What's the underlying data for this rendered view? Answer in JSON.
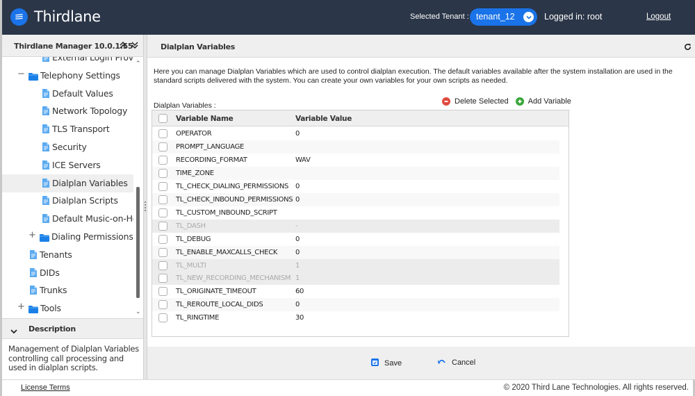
{
  "header": {
    "brand": "Thirdlane",
    "tenant_label": "Selected Tenant :",
    "tenant_value": "tenant_12",
    "logged_in": "Logged in: root",
    "logout": "Logout",
    "accent_color": "#1a73e8",
    "bar_color": "#2b3648"
  },
  "left_panel": {
    "title": "Thirdlane Manager 10.0.1.55",
    "tree": [
      {
        "label": "External Login Provi...",
        "type": "file",
        "level": 2,
        "partial": true
      },
      {
        "label": "Telephony Settings",
        "type": "folder",
        "level": 1,
        "toggle": "−"
      },
      {
        "label": "Default Values",
        "type": "file",
        "level": 2
      },
      {
        "label": "Network Topology",
        "type": "file",
        "level": 2
      },
      {
        "label": "TLS Transport",
        "type": "file",
        "level": 2
      },
      {
        "label": "Security",
        "type": "file",
        "level": 2
      },
      {
        "label": "ICE Servers",
        "type": "file",
        "level": 2
      },
      {
        "label": "Dialplan Variables",
        "type": "file",
        "level": 2,
        "selected": true
      },
      {
        "label": "Dialplan Scripts",
        "type": "file",
        "level": 2
      },
      {
        "label": "Default Music-on-Hold",
        "type": "file",
        "level": 2
      },
      {
        "label": "Dialing Permissions",
        "type": "folder",
        "level": 2,
        "toggle": "+"
      },
      {
        "label": "Tenants",
        "type": "file",
        "level": 1
      },
      {
        "label": "DIDs",
        "type": "file",
        "level": 1
      },
      {
        "label": "Trunks",
        "type": "file",
        "level": 1
      },
      {
        "label": "Tools",
        "type": "folder",
        "level": 1,
        "toggle": "+"
      }
    ],
    "description_title": "Description",
    "description_text": "Management of Dialplan Variables controlling call processing and used in dialplan scripts."
  },
  "main": {
    "title": "Dialplan Variables",
    "intro": "Here you can manage Dialplan Variables which are used to control dialplan execution. The default variables available after the system installation are used in the standard scripts delivered with the system. You can create your own variables for your own scripts as needed.",
    "grid_label": "Dialplan Variables :",
    "delete_label": "Delete Selected",
    "add_label": "Add Variable",
    "columns": [
      "Variable Name",
      "Variable Value"
    ],
    "rows": [
      {
        "name": "OPERATOR",
        "value": "0",
        "disabled": false
      },
      {
        "name": "PROMPT_LANGUAGE",
        "value": "",
        "disabled": false
      },
      {
        "name": "RECORDING_FORMAT",
        "value": "WAV",
        "disabled": false
      },
      {
        "name": "TIME_ZONE",
        "value": "",
        "disabled": false
      },
      {
        "name": "TL_CHECK_DIALING_PERMISSIONS",
        "value": "0",
        "disabled": false
      },
      {
        "name": "TL_CHECK_INBOUND_PERMISSIONS",
        "value": "0",
        "disabled": false
      },
      {
        "name": "TL_CUSTOM_INBOUND_SCRIPT",
        "value": "",
        "disabled": false
      },
      {
        "name": "TL_DASH",
        "value": "-",
        "disabled": true
      },
      {
        "name": "TL_DEBUG",
        "value": "0",
        "disabled": false
      },
      {
        "name": "TL_ENABLE_MAXCALLS_CHECK",
        "value": "0",
        "disabled": false
      },
      {
        "name": "TL_MULTI",
        "value": "1",
        "disabled": true
      },
      {
        "name": "TL_NEW_RECORDING_MECHANISM",
        "value": "1",
        "disabled": true
      },
      {
        "name": "TL_ORIGINATE_TIMEOUT",
        "value": "60",
        "disabled": false
      },
      {
        "name": "TL_REROUTE_LOCAL_DIDS",
        "value": "0",
        "disabled": false
      },
      {
        "name": "TL_RINGTIME",
        "value": "30",
        "disabled": false
      }
    ],
    "save_label": "Save",
    "cancel_label": "Cancel"
  },
  "footer": {
    "license": "License Terms",
    "copyright": "© 2020 Third Lane Technologies. All rights reserved."
  },
  "icons": {
    "logo": "stacked-lines-icon",
    "tenant_dropdown": "chevron-down-icon",
    "expand_all": "double-chevron-up-icon",
    "collapse_all": "double-chevron-down-icon",
    "refresh": "refresh-icon",
    "delete": "minus-circle-icon",
    "add": "plus-circle-icon",
    "save": "save-icon",
    "cancel": "undo-icon",
    "folder": "folder-icon",
    "file": "file-icon"
  }
}
